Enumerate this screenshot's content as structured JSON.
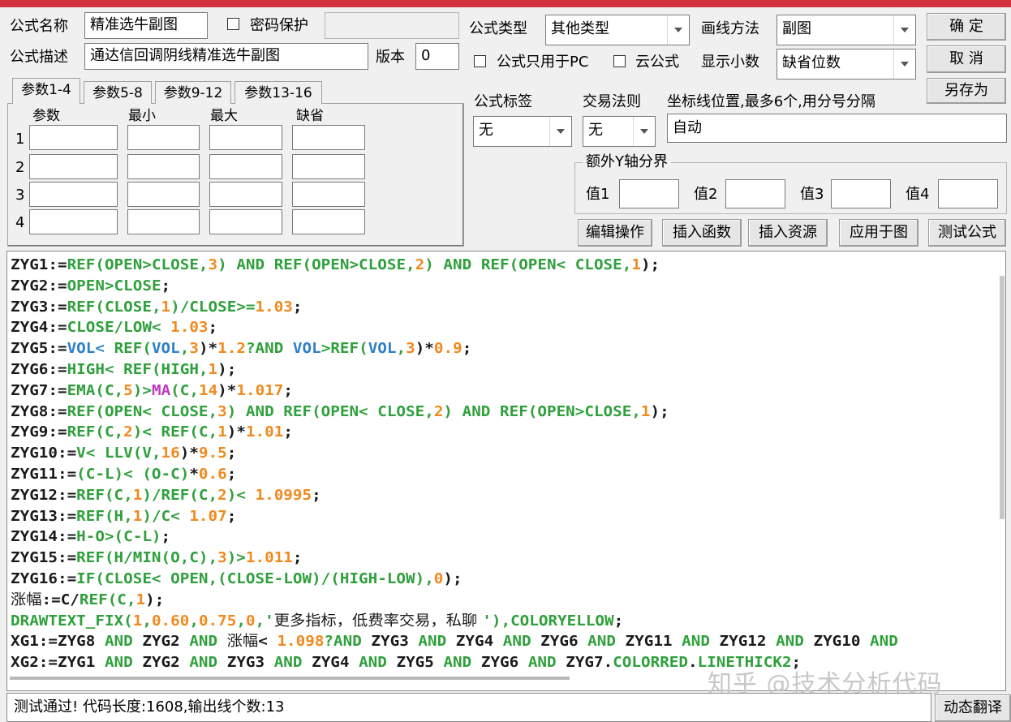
{
  "header": {
    "name_label": "公式名称",
    "name_value": "精准选牛副图",
    "password_label": "密码保护",
    "password_value": "",
    "desc_label": "公式描述",
    "desc_value": "通达信回调阴线精准选牛副图",
    "version_label": "版本",
    "version_value": "0",
    "type_label": "公式类型",
    "type_value": "其他类型",
    "draw_label": "画线方法",
    "draw_value": "副图",
    "pc_only_label": "公式只用于PC",
    "cloud_label": "云公式",
    "decimal_label": "显示小数",
    "decimal_value": "缺省位数"
  },
  "buttons": {
    "ok": "确  定",
    "cancel": "取  消",
    "save_as": "另存为",
    "edit_ops": "编辑操作",
    "insert_func": "插入函数",
    "insert_res": "插入资源",
    "apply_chart": "应用于图",
    "test_formula": "测试公式",
    "dynamic_translate": "动态翻译"
  },
  "tabs": [
    "参数1-4",
    "参数5-8",
    "参数9-12",
    "参数13-16"
  ],
  "params": {
    "headers": [
      "参数",
      "最小",
      "最大",
      "缺省"
    ],
    "rows": [
      "1",
      "2",
      "3",
      "4"
    ]
  },
  "tagging": {
    "tag_label": "公式标签",
    "tag_value": "无",
    "rule_label": "交易法则",
    "rule_value": "无",
    "coord_label": "坐标线位置,最多6个,用分号分隔",
    "coord_value": "自动"
  },
  "yaxis": {
    "group_label": "额外Y轴分界",
    "v1": "值1",
    "v2": "值2",
    "v3": "值3",
    "v4": "值4"
  },
  "code_lines": [
    [
      [
        "k",
        "ZYG1:="
      ],
      [
        "f",
        "REF(OPEN>CLOSE,"
      ],
      [
        "n",
        "3"
      ],
      [
        "f",
        ") AND REF(OPEN>CLOSE,"
      ],
      [
        "n",
        "2"
      ],
      [
        "f",
        ") AND REF(OPEN< CLOSE,"
      ],
      [
        "n",
        "1"
      ],
      [
        "k",
        ");"
      ]
    ],
    [
      [
        "k",
        "ZYG2:="
      ],
      [
        "f",
        "OPEN>CLOSE"
      ],
      [
        "k",
        ";"
      ]
    ],
    [
      [
        "k",
        "ZYG3:="
      ],
      [
        "f",
        "REF(CLOSE,"
      ],
      [
        "n",
        "1"
      ],
      [
        "f",
        ")/CLOSE>="
      ],
      [
        "n",
        "1.03"
      ],
      [
        "k",
        ";"
      ]
    ],
    [
      [
        "k",
        "ZYG4:="
      ],
      [
        "f",
        "CLOSE/LOW< "
      ],
      [
        "n",
        "1.03"
      ],
      [
        "k",
        ";"
      ]
    ],
    [
      [
        "k",
        "ZYG5:="
      ],
      [
        "b",
        "VOL< "
      ],
      [
        "f",
        "REF("
      ],
      [
        "b",
        "VOL"
      ],
      [
        "f",
        ","
      ],
      [
        "n",
        "3"
      ],
      [
        "k",
        ")*"
      ],
      [
        "n",
        "1.2"
      ],
      [
        "f",
        "?AND "
      ],
      [
        "b",
        "VOL"
      ],
      [
        "f",
        ">REF("
      ],
      [
        "b",
        "VOL"
      ],
      [
        "f",
        ","
      ],
      [
        "n",
        "3"
      ],
      [
        "k",
        ")*"
      ],
      [
        "n",
        "0.9"
      ],
      [
        "k",
        ";"
      ]
    ],
    [
      [
        "k",
        "ZYG6:="
      ],
      [
        "f",
        "HIGH< REF(HIGH,"
      ],
      [
        "n",
        "1"
      ],
      [
        "k",
        ");"
      ]
    ],
    [
      [
        "k",
        "ZYG7:="
      ],
      [
        "f",
        "EMA(C,"
      ],
      [
        "n",
        "5"
      ],
      [
        "f",
        ")>"
      ],
      [
        "m",
        "MA"
      ],
      [
        "f",
        "(C,"
      ],
      [
        "n",
        "14"
      ],
      [
        "k",
        ")*"
      ],
      [
        "n",
        "1.017"
      ],
      [
        "k",
        ";"
      ]
    ],
    [
      [
        "k",
        "ZYG8:="
      ],
      [
        "f",
        "REF(OPEN< CLOSE,"
      ],
      [
        "n",
        "3"
      ],
      [
        "f",
        ") AND REF(OPEN< CLOSE,"
      ],
      [
        "n",
        "2"
      ],
      [
        "f",
        ") AND REF(OPEN>CLOSE,"
      ],
      [
        "n",
        "1"
      ],
      [
        "k",
        ");"
      ]
    ],
    [
      [
        "k",
        "ZYG9:="
      ],
      [
        "f",
        "REF(C,"
      ],
      [
        "n",
        "2"
      ],
      [
        "f",
        ")< REF(C,"
      ],
      [
        "n",
        "1"
      ],
      [
        "k",
        ")*"
      ],
      [
        "n",
        "1.01"
      ],
      [
        "k",
        ";"
      ]
    ],
    [
      [
        "k",
        "ZYG10:="
      ],
      [
        "f",
        "V< LLV(V,"
      ],
      [
        "n",
        "16"
      ],
      [
        "k",
        ")*"
      ],
      [
        "n",
        "9.5"
      ],
      [
        "k",
        ";"
      ]
    ],
    [
      [
        "k",
        "ZYG11:="
      ],
      [
        "f",
        "(C-L)< (O-C)"
      ],
      [
        "k",
        "*"
      ],
      [
        "n",
        "0.6"
      ],
      [
        "k",
        ";"
      ]
    ],
    [
      [
        "k",
        "ZYG12:="
      ],
      [
        "f",
        "REF(C,"
      ],
      [
        "n",
        "1"
      ],
      [
        "f",
        ")/REF(C,"
      ],
      [
        "n",
        "2"
      ],
      [
        "f",
        ")< "
      ],
      [
        "n",
        "1.0995"
      ],
      [
        "k",
        ";"
      ]
    ],
    [
      [
        "k",
        "ZYG13:="
      ],
      [
        "f",
        "REF(H,"
      ],
      [
        "n",
        "1"
      ],
      [
        "f",
        ")/C< "
      ],
      [
        "n",
        "1.07"
      ],
      [
        "k",
        ";"
      ]
    ],
    [
      [
        "k",
        "ZYG14:="
      ],
      [
        "f",
        "H-O>(C-L)"
      ],
      [
        "k",
        ";"
      ]
    ],
    [
      [
        "k",
        "ZYG15:="
      ],
      [
        "f",
        "REF(H/MIN(O,C),"
      ],
      [
        "n",
        "3"
      ],
      [
        "f",
        ")>"
      ],
      [
        "n",
        "1.011"
      ],
      [
        "k",
        ";"
      ]
    ],
    [
      [
        "k",
        "ZYG16:="
      ],
      [
        "f",
        "IF(CLOSE< OPEN,(CLOSE-LOW)/(HIGH-LOW),"
      ],
      [
        "n",
        "0"
      ],
      [
        "k",
        ");"
      ]
    ],
    [
      [
        "s",
        "涨幅"
      ],
      [
        "k",
        ":=C/"
      ],
      [
        "f",
        "REF(C,"
      ],
      [
        "n",
        "1"
      ],
      [
        "k",
        ");"
      ]
    ],
    [
      [
        "f",
        "DRAWTEXT_FIX("
      ],
      [
        "n",
        "1"
      ],
      [
        "f",
        ","
      ],
      [
        "n",
        "0.60"
      ],
      [
        "f",
        ","
      ],
      [
        "n",
        "0.75"
      ],
      [
        "f",
        ","
      ],
      [
        "n",
        "0"
      ],
      [
        "f",
        ",'"
      ],
      [
        "s",
        "更多指标，低费率交易，私聊 "
      ],
      [
        "f",
        "'),COLORYELLOW"
      ],
      [
        "k",
        ";"
      ]
    ],
    [
      [
        "k",
        "XG1:=ZYG8 "
      ],
      [
        "f",
        "AND"
      ],
      [
        "k",
        " ZYG2 "
      ],
      [
        "f",
        "AND"
      ],
      [
        "k",
        " "
      ],
      [
        "s",
        "涨幅"
      ],
      [
        "k",
        "< "
      ],
      [
        "n",
        "1.098"
      ],
      [
        "f",
        "?AND"
      ],
      [
        "k",
        " ZYG3 "
      ],
      [
        "f",
        "AND"
      ],
      [
        "k",
        " ZYG4 "
      ],
      [
        "f",
        "AND"
      ],
      [
        "k",
        " ZYG6 "
      ],
      [
        "f",
        "AND"
      ],
      [
        "k",
        " ZYG11 "
      ],
      [
        "f",
        "AND"
      ],
      [
        "k",
        " ZYG12 "
      ],
      [
        "f",
        "AND"
      ],
      [
        "k",
        " ZYG10 "
      ],
      [
        "f",
        "AND"
      ]
    ],
    [
      [
        "k",
        "XG2:=ZYG1 "
      ],
      [
        "f",
        "AND"
      ],
      [
        "k",
        " ZYG2 "
      ],
      [
        "f",
        "AND"
      ],
      [
        "k",
        " ZYG3 "
      ],
      [
        "f",
        "AND"
      ],
      [
        "k",
        " ZYG4 "
      ],
      [
        "f",
        "AND"
      ],
      [
        "k",
        " ZYG5 "
      ],
      [
        "f",
        "AND"
      ],
      [
        "k",
        " ZYG6 "
      ],
      [
        "f",
        "AND"
      ],
      [
        "k",
        " ZYG7."
      ],
      [
        "f",
        "COLORRED"
      ],
      [
        "k",
        "."
      ],
      [
        "f",
        "LINETHICK2"
      ],
      [
        "k",
        ";"
      ]
    ]
  ],
  "status": {
    "text": "测试通过! 代码长度:1608,输出线个数:13"
  },
  "watermark": "知乎 @技术分析代码"
}
